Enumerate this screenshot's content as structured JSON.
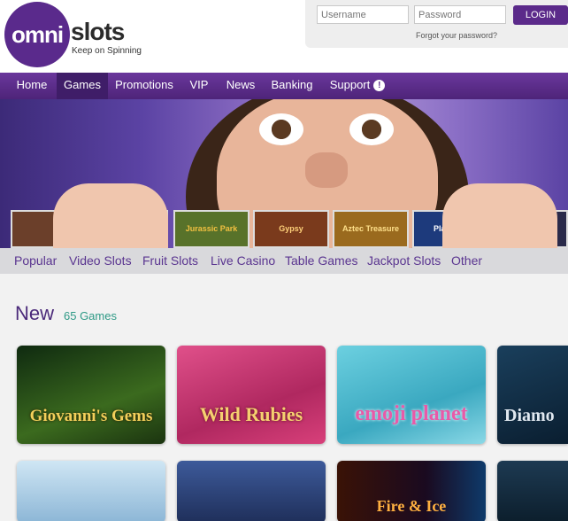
{
  "header": {
    "logo_circle": "omni",
    "logo_word": "slots",
    "tagline": "Keep on Spinning",
    "username_placeholder": "Username",
    "password_placeholder": "Password",
    "login_label": "LOGIN",
    "forgot_label": "Forgot your password?"
  },
  "nav": {
    "items": [
      "Home",
      "Games",
      "Promotions",
      "VIP",
      "News",
      "Banking",
      "Support"
    ],
    "active": "Games",
    "support_badge": "!"
  },
  "hero": {
    "thumbnails": [
      "",
      "",
      "Jurassic Park",
      "Gypsy",
      "Aztec Treasure",
      "Platinum",
      ""
    ]
  },
  "categories": [
    "Popular",
    "Video Slots",
    "Fruit Slots",
    "Live Casino",
    "Table Games",
    "Jackpot Slots",
    "Other"
  ],
  "section": {
    "title": "New",
    "count": "65 Games"
  },
  "games": [
    {
      "name": "Giovanni's Gems",
      "color": "#1f3d16"
    },
    {
      "name": "Wild Rubies",
      "color": "#c0306a"
    },
    {
      "name": "emoji planet",
      "color": "#4fb4c8"
    },
    {
      "name": "Diamo",
      "color": "#0d2c44"
    }
  ],
  "games_row2": [
    {
      "name": "",
      "color": "#b9d7ea"
    },
    {
      "name": "",
      "color": "#2d4680"
    },
    {
      "name": "Fire & Ice",
      "color": "#2a0f06"
    },
    {
      "name": "",
      "color": "#10293d"
    }
  ],
  "colors": {
    "brand_purple": "#5b2a8a",
    "accent_teal": "#2f9a86"
  }
}
